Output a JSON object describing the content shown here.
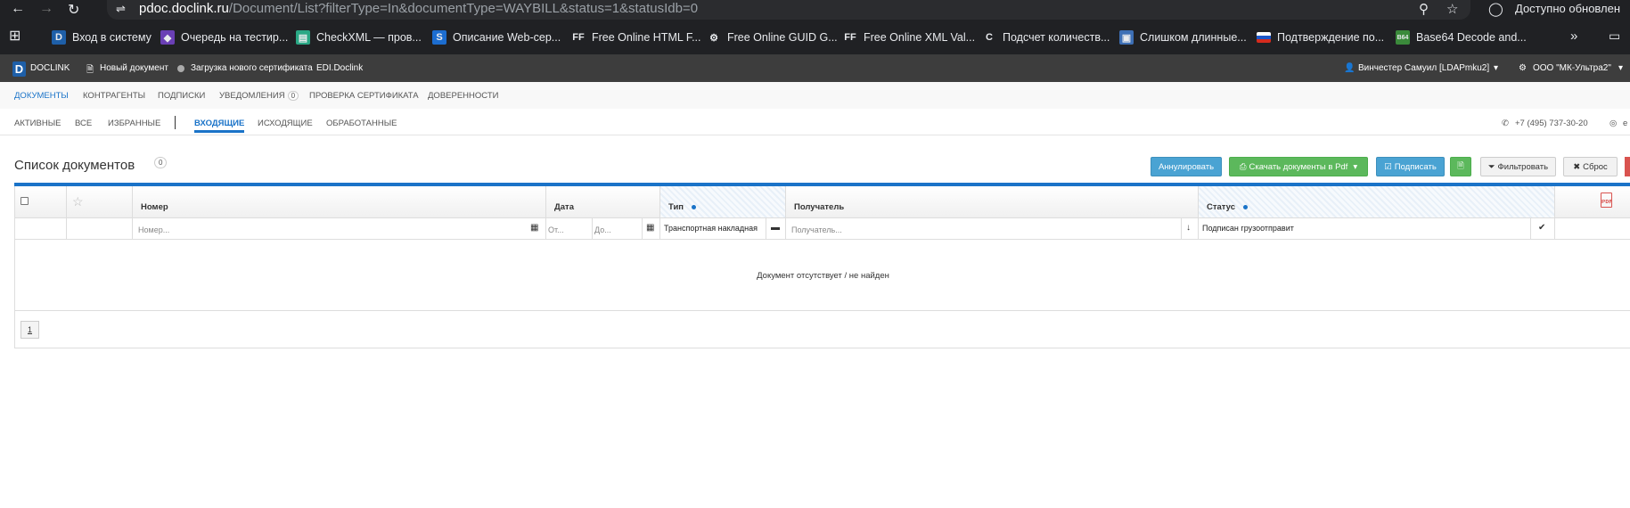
{
  "browser": {
    "url_host": "pdoc.doclink.ru",
    "url_path": "/Document/List?filterType=In&documentType=WAYBILL&status=1&statusIdb=0",
    "update_text": "Доступно обновлен",
    "bookmarks": [
      {
        "label": "Вход в систему",
        "icon": "doclink-icon",
        "fav": "D",
        "bg": "#1e5fa8"
      },
      {
        "label": "Очередь на тестир...",
        "icon": "visual-studio-icon",
        "fav": "◆",
        "bg": "#6a3fb5"
      },
      {
        "label": "CheckXML — пров...",
        "icon": "document-icon",
        "fav": "▤",
        "bg": "#2aa885"
      },
      {
        "label": "Описание Web-сер...",
        "icon": "s-icon",
        "fav": "S",
        "bg": "#1c6dd0"
      },
      {
        "label": "Free Online HTML F...",
        "icon": "ff-icon",
        "fav": "FF",
        "bg": "#202124"
      },
      {
        "label": "Free Online GUID G...",
        "icon": "gear-icon",
        "fav": "⚙",
        "bg": "#202124"
      },
      {
        "label": "Free Online XML Val...",
        "icon": "ff-icon",
        "fav": "FF",
        "bg": "#202124"
      },
      {
        "label": "Подсчет количеств...",
        "icon": "copyright-icon",
        "fav": "C",
        "bg": "#202124"
      },
      {
        "label": "Слишком длинные...",
        "icon": "image-icon",
        "fav": "▣",
        "bg": "#3d6fb5"
      },
      {
        "label": "Подтверждение по...",
        "icon": "russia-flag-icon",
        "fav": "",
        "bg": "#ffffff"
      },
      {
        "label": "Base64 Decode and...",
        "icon": "b64-icon",
        "fav": "B64",
        "bg": "#3b8a3b"
      }
    ]
  },
  "topbar": {
    "brand": "DOCLINK",
    "new_doc": "Новый документ",
    "upload_cert": "Загрузка нового сертификата",
    "edi": "EDI.Doclink",
    "user": "Винчестер Самуил [LDAPmku2]",
    "org": "ООО \"МК-Ультра2\""
  },
  "nav1": [
    {
      "label": "ДОКУМЕНТЫ",
      "active": true
    },
    {
      "label": "КОНТРАГЕНТЫ"
    },
    {
      "label": "ПОДПИСКИ"
    },
    {
      "label": "УВЕДОМЛЕНИЯ",
      "badge": "0"
    },
    {
      "label": "ПРОВЕРКА СЕРТИФИКАТА"
    },
    {
      "label": "ДОВЕРЕННОСТИ"
    }
  ],
  "nav2": [
    {
      "label": "АКТИВНЫЕ"
    },
    {
      "label": "ВСЕ"
    },
    {
      "label": "ИЗБРАННЫЕ"
    },
    {
      "label": "ВХОДЯЩИЕ",
      "active": true
    },
    {
      "label": "ИСХОДЯЩИЕ"
    },
    {
      "label": "ОБРАБОТАННЫЕ"
    }
  ],
  "contact": {
    "phone": "+7 (495) 737-30-20",
    "email_fragment": "e"
  },
  "page": {
    "title": "Список документов",
    "count": "0"
  },
  "actions": {
    "annul": "Аннулировать",
    "download_pdf": "Скачать документы в Pdf",
    "sign": "Подписать",
    "filter": "Фильтровать",
    "reset": "Сброс"
  },
  "table": {
    "headers": {
      "number": "Номер",
      "date": "Дата",
      "type": "Тип",
      "recipient": "Получатель",
      "status": "Статус"
    },
    "filters": {
      "number_placeholder": "Номер...",
      "date_from": "От...",
      "date_to": "До...",
      "type_value": "Транспортная накладная",
      "recipient_placeholder": "Получатель...",
      "status_value": "Подписан грузоотправит"
    },
    "empty_message": "Документ отсутствует / не найден",
    "pages": [
      "1"
    ]
  }
}
